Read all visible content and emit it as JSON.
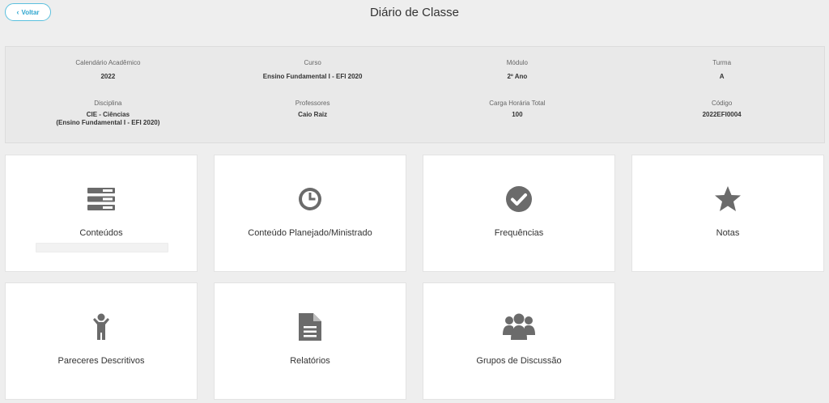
{
  "header": {
    "back_label": "Voltar",
    "title": "Diário de Classe"
  },
  "info": {
    "calendario": {
      "label": "Calendário Acadêmico",
      "value": "2022"
    },
    "curso": {
      "label": "Curso",
      "value": "Ensino Fundamental I - EFI 2020"
    },
    "modulo": {
      "label": "Módulo",
      "value": "2º Ano"
    },
    "turma": {
      "label": "Turma",
      "value": "A"
    },
    "disciplina": {
      "label": "Disciplina",
      "value_line1": "CIE - Ciências",
      "value_line2": "(Ensino Fundamental I - EFI 2020)"
    },
    "professores": {
      "label": "Professores",
      "value": "Caio Raiz"
    },
    "carga": {
      "label": "Carga Horária Total",
      "value": "100"
    },
    "codigo": {
      "label": "Código",
      "value": "2022EFI0004"
    }
  },
  "cards": {
    "conteudos": {
      "label": "Conteúdos",
      "icon": "list-icon",
      "progress": 0
    },
    "planejado": {
      "label": "Conteúdo Planejado/Ministrado",
      "icon": "clock-icon"
    },
    "frequencias": {
      "label": "Frequências",
      "icon": "check-circle-icon"
    },
    "notas": {
      "label": "Notas",
      "icon": "star-icon"
    },
    "pareceres": {
      "label": "Pareceres Descritivos",
      "icon": "child-icon"
    },
    "relatorios": {
      "label": "Relatórios",
      "icon": "file-text-icon"
    },
    "grupos": {
      "label": "Grupos de Discussão",
      "icon": "users-icon"
    }
  },
  "colors": {
    "icon": "#6b6b6b",
    "accent": "#5bc0de"
  }
}
